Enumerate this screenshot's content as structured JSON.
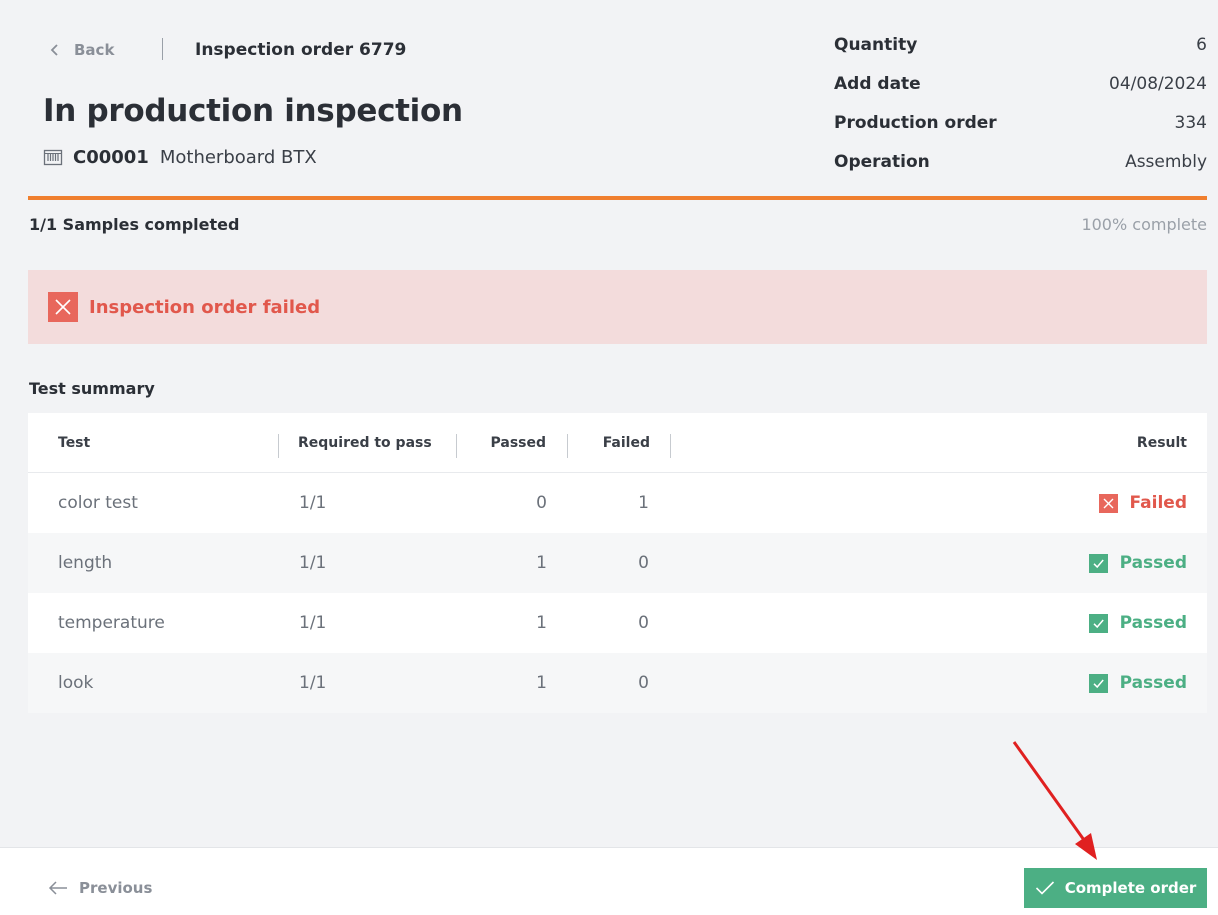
{
  "nav": {
    "back_label": "Back",
    "order_title": "Inspection order 6779"
  },
  "page": {
    "title": "In production inspection",
    "product_icon": "barcode-box-icon",
    "product_code": "C00001",
    "product_name": "Motherboard BTX"
  },
  "meta": [
    {
      "label": "Quantity",
      "value": "6"
    },
    {
      "label": "Add date",
      "value": "04/08/2024"
    },
    {
      "label": "Production order",
      "value": "334"
    },
    {
      "label": "Operation",
      "value": "Assembly"
    }
  ],
  "progress": {
    "samples_text": "1/1 Samples completed",
    "percent_text": "100% complete",
    "fraction": 1.0
  },
  "alert": {
    "text": "Inspection order failed",
    "icon": "close-x-icon"
  },
  "summary": {
    "title": "Test summary",
    "columns": {
      "test": "Test",
      "required": "Required to pass",
      "passed": "Passed",
      "failed": "Failed",
      "result": "Result"
    },
    "rows": [
      {
        "test": "color test",
        "required": "1/1",
        "passed": "0",
        "failed": "1",
        "result": "Failed",
        "status": "failed"
      },
      {
        "test": "length",
        "required": "1/1",
        "passed": "1",
        "failed": "0",
        "result": "Passed",
        "status": "passed"
      },
      {
        "test": "temperature",
        "required": "1/1",
        "passed": "1",
        "failed": "0",
        "result": "Passed",
        "status": "passed"
      },
      {
        "test": "look",
        "required": "1/1",
        "passed": "1",
        "failed": "0",
        "result": "Passed",
        "status": "passed"
      }
    ]
  },
  "footer": {
    "previous_label": "Previous",
    "complete_label": "Complete order"
  },
  "colors": {
    "accent_orange": "#f07f2e",
    "success_green": "#4caf84",
    "danger_red": "#e1584c",
    "alert_bg": "#f3dcdc",
    "annotation_arrow": "#e02020"
  }
}
